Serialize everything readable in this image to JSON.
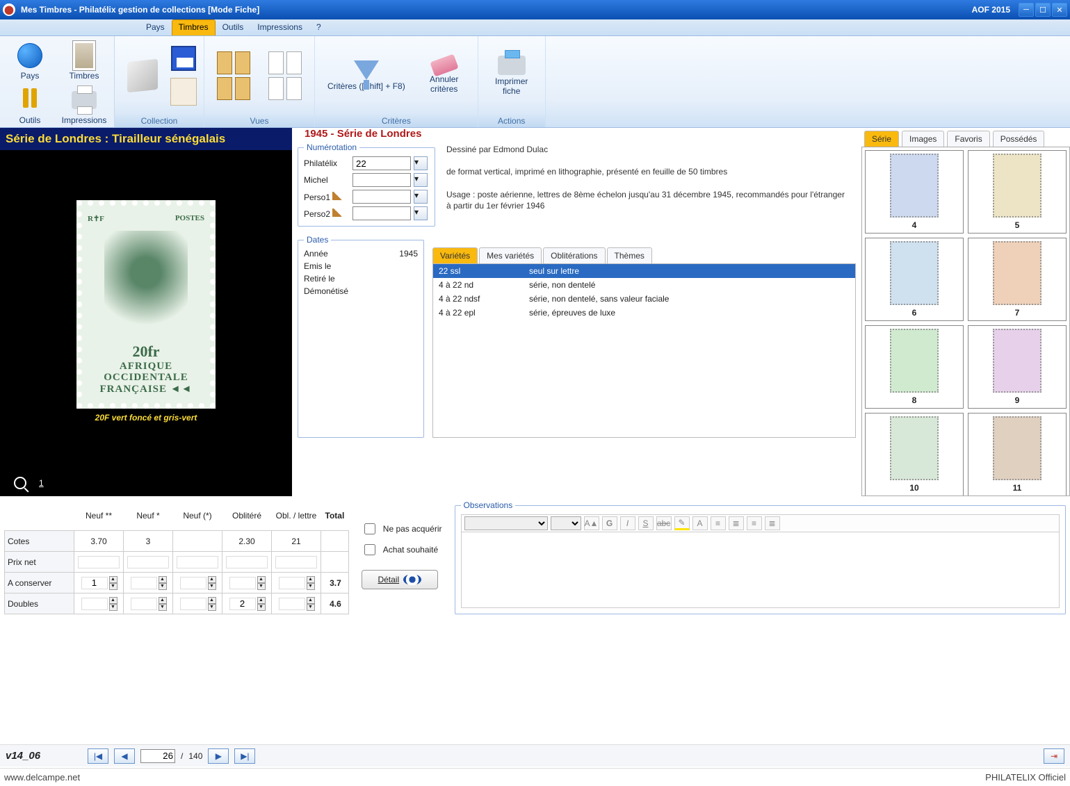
{
  "window": {
    "title": "Mes Timbres - Philatélix gestion de collections [Mode Fiche]",
    "right": "AOF 2015"
  },
  "menu": {
    "items": [
      "Pays",
      "Timbres",
      "Outils",
      "Impressions",
      "?"
    ],
    "active_index": 1
  },
  "launch": {
    "pays": "Pays",
    "timbres": "Timbres",
    "outils": "Outils",
    "impressions": "Impressions"
  },
  "ribbon": {
    "collection": "Collection",
    "vues": "Vues",
    "criteres_cap": "Critères",
    "actions": "Actions",
    "criteres_btn": "Critères ([Shift] + F8)",
    "annuler": "Annuler critères",
    "imprimer": "Imprimer fiche"
  },
  "series": {
    "heading": "1945 - Série de Londres",
    "strip": "Série de Londres : Tirailleur sénégalais"
  },
  "stamp_caption": "20F vert foncé et gris-vert",
  "stamp_index": "1",
  "numbering": {
    "legend": "Numérotation",
    "labels": {
      "philatelix": "Philatélix",
      "michel": "Michel",
      "perso1": "Perso1",
      "perso2": "Perso2"
    },
    "values": {
      "philatelix": "22",
      "michel": "",
      "perso1": "",
      "perso2": ""
    }
  },
  "description": {
    "line1": "Dessiné par Edmond Dulac",
    "line2": "de format vertical, imprimé en lithographie, présenté en feuille de 50 timbres",
    "line3": "Usage : poste aérienne, lettres de 8ème échelon jusqu'au 31 décembre 1945, recommandés pour l'étranger à partir du 1er février 1946"
  },
  "dates": {
    "legend": "Dates",
    "labels": {
      "annee": "Année",
      "emis": "Emis le",
      "retire": "Retiré le",
      "demon": "Démonétisé"
    },
    "values": {
      "annee": "1945",
      "emis": "",
      "retire": "",
      "demon": ""
    }
  },
  "var_tabs": [
    "Variétés",
    "Mes variétés",
    "Oblitérations",
    "Thèmes"
  ],
  "varieties": [
    {
      "code": "22 ssl",
      "desc": "seul sur lettre"
    },
    {
      "code": "4 à 22 nd",
      "desc": "série, non dentelé"
    },
    {
      "code": "4 à 22 ndsf",
      "desc": "série, non dentelé, sans valeur faciale"
    },
    {
      "code": "4 à 22 epl",
      "desc": "série, épreuves de luxe"
    }
  ],
  "thumb_tabs": [
    "Série",
    "Images",
    "Favoris",
    "Possédés"
  ],
  "thumbs": [
    {
      "n": "4"
    },
    {
      "n": "5"
    },
    {
      "n": "6"
    },
    {
      "n": "7"
    },
    {
      "n": "8"
    },
    {
      "n": "9"
    },
    {
      "n": "10"
    },
    {
      "n": "11"
    }
  ],
  "price": {
    "headers": [
      "Neuf **",
      "Neuf *",
      "Neuf (*)",
      "Oblitéré",
      "Obl. / lettre",
      "Total"
    ],
    "rows": {
      "cotes": "Cotes",
      "prixnet": "Prix net",
      "aconserver": "A conserver",
      "doubles": "Doubles"
    },
    "cotes": [
      "3.70",
      "3",
      "",
      "2.30",
      "21"
    ],
    "aconserver": [
      "1",
      "",
      "",
      "",
      ""
    ],
    "aconserver_total": "3.7",
    "doubles": [
      "",
      "",
      "",
      "2",
      ""
    ],
    "doubles_total": "4.6"
  },
  "checks": {
    "ne_pas": "Ne pas acquérir",
    "achat": "Achat souhaité",
    "detail": "Détail"
  },
  "obs": {
    "legend": "Observations"
  },
  "nav": {
    "version": "v14_06",
    "current": "26",
    "total": "140"
  },
  "bottom": {
    "left": "www.delcampe.net",
    "right": "PHILATELIX Officiel"
  }
}
